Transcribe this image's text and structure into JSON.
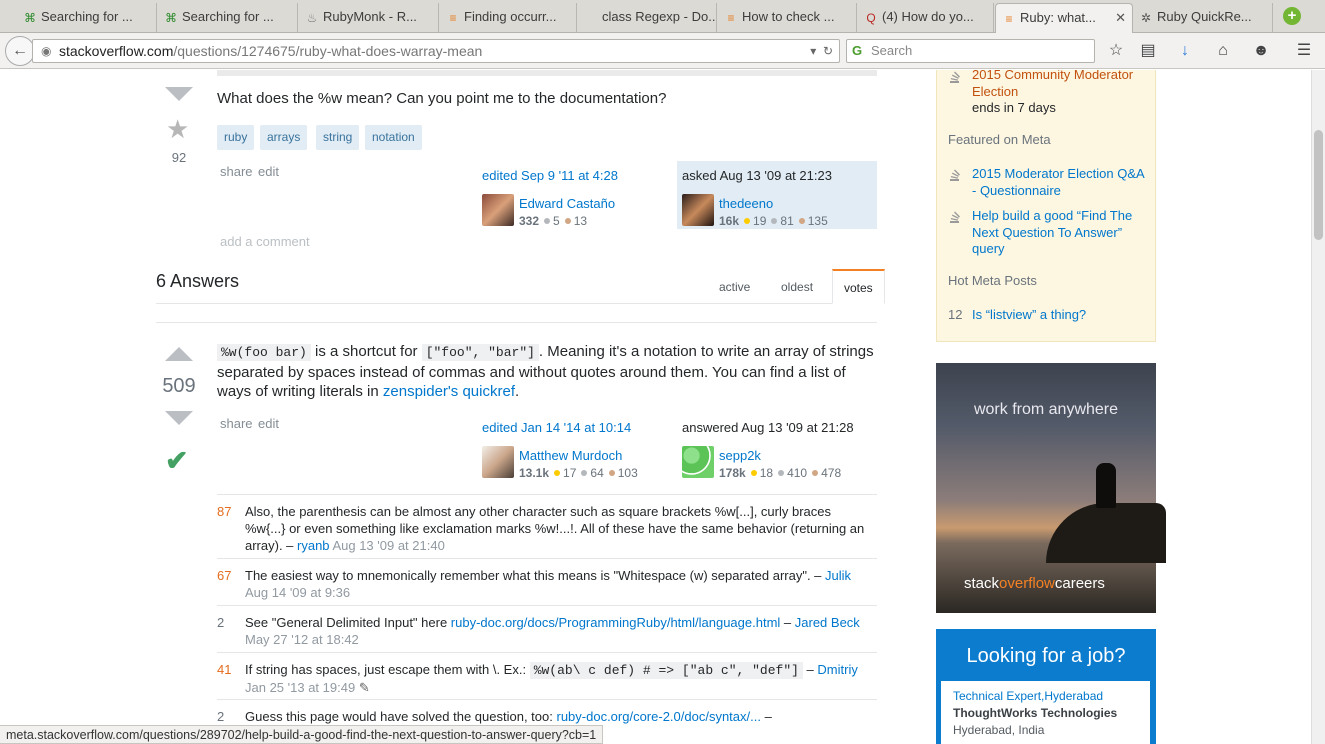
{
  "tabs": [
    {
      "label": "Searching for ...",
      "icon": "⌘",
      "iconColor": "#2c8a2c"
    },
    {
      "label": "Searching for ...",
      "icon": "⌘",
      "iconColor": "#2c8a2c"
    },
    {
      "label": "RubyMonk - R...",
      "icon": "♨",
      "iconColor": "#777"
    },
    {
      "label": "Finding occurr...",
      "icon": "≡",
      "iconColor": "#e67e22"
    },
    {
      "label": "class Regexp - Do...",
      "icon": "",
      "iconColor": "#777"
    },
    {
      "label": "How to check ...",
      "icon": "≡",
      "iconColor": "#e67e22"
    },
    {
      "label": "(4) How do yo...",
      "icon": "Q",
      "iconColor": "#b92b27"
    },
    {
      "label": "Ruby: what...",
      "icon": "≡",
      "iconColor": "#e67e22"
    },
    {
      "label": "Ruby QuickRe...",
      "icon": "✲",
      "iconColor": "#555"
    }
  ],
  "nav": {
    "url_host": "stackoverflow.com",
    "url_path": "/questions/1274675/ruby-what-does-warray-mean",
    "search_placeholder": "Search"
  },
  "question": {
    "text": "What does the %w mean? Can you point me to the documentation?",
    "votes": "92",
    "tags": [
      "ruby",
      "arrays",
      "string",
      "notation"
    ],
    "share": "share",
    "edit": "edit",
    "add_comment": "add a comment",
    "editor": {
      "action": "edited Sep 9 '11 at 4:28",
      "name": "Edward Castaño",
      "rep": "332",
      "gold": "",
      "silver": "5",
      "bronze": "13"
    },
    "asker": {
      "action": "asked Aug 13 '09 at 21:23",
      "name": "thedeeno",
      "rep": "16k",
      "gold": "19",
      "silver": "81",
      "bronze": "135"
    }
  },
  "answers_header": "6 Answers",
  "sort_tabs": {
    "active": "active",
    "oldest": "oldest",
    "votes": "votes"
  },
  "answer": {
    "votes": "509",
    "code1": "%w(foo bar)",
    "t1": " is a shortcut for ",
    "code2": "[\"foo\", \"bar\"]",
    "t2": ". Meaning it's a notation to write an array of strings separated by spaces instead of commas and without quotes around them. You can find a list of ways of writing literals in ",
    "link": "zenspider's quickref",
    "t3": ".",
    "share": "share",
    "edit": "edit",
    "editor": {
      "action": "edited Jan 14 '14 at 10:14",
      "name": "Matthew Murdoch",
      "rep": "13.1k",
      "gold": "17",
      "silver": "64",
      "bronze": "103"
    },
    "answerer": {
      "action": "answered Aug 13 '09 at 21:28",
      "name": "sepp2k",
      "rep": "178k",
      "gold": "18",
      "silver": "410",
      "bronze": "478"
    }
  },
  "comments": [
    {
      "score": "87",
      "hot": true,
      "text": "Also, the parenthesis can be almost any other character such as square brackets %w[...], curly braces %w{...} or even something like exclamation marks %w!...!. All of these have the same behavior (returning an array). – ",
      "user": "ryanb",
      "date": "Aug 13 '09 at 21:40"
    },
    {
      "score": "67",
      "hot": true,
      "text": "The easiest way to mnemonically remember what this means is \"Whitespace (w) separated array\". – ",
      "user": "Julik",
      "date": "Aug 14 '09 at 9:36"
    },
    {
      "score": "2",
      "hot": false,
      "text": "See \"General Delimited Input\" here ",
      "link": "ruby-doc.org/docs/ProgrammingRuby/html/language.html",
      "text2": " – ",
      "user": "Jared Beck",
      "date": "May 27 '12 at 18:42"
    },
    {
      "score": "41",
      "hot": true,
      "text": "If string has spaces, just escape them with \\. Ex.: ",
      "code": "%w(ab\\ c def) # => [\"ab c\", \"def\"]",
      "text2": " – ",
      "user": "Dmitriy",
      "date": "Jan 25 '13 at 19:49"
    },
    {
      "score": "2",
      "hot": false,
      "text": "Guess this page would have solved the question, too: ",
      "link": "ruby-doc.org/core-2.0/doc/syntax/...",
      "text2": " –"
    }
  ],
  "sidebar": {
    "election": "2015 Community Moderator Election",
    "ends": "ends in 7 days",
    "featured_hdr": "Featured on Meta",
    "featured": [
      "2015 Moderator Election Q&A - Questionnaire",
      "Help build a good “Find The Next Question To Answer” query"
    ],
    "hot_hdr": "Hot Meta Posts",
    "hot_count": "12",
    "hot_item": "Is “listview” a thing?"
  },
  "ad": {
    "text": "work from anywhere",
    "logo_a": "stack",
    "logo_b": "overflow",
    "logo_c": "careers"
  },
  "jobs": {
    "title": "Looking for a job?",
    "job_title": "Technical Expert,Hyderabad",
    "company": "ThoughtWorks Technologies",
    "location": "Hyderabad, India"
  },
  "status_url": "meta.stackoverflow.com/questions/289702/help-build-a-good-find-the-next-question-to-answer-query?cb=1"
}
